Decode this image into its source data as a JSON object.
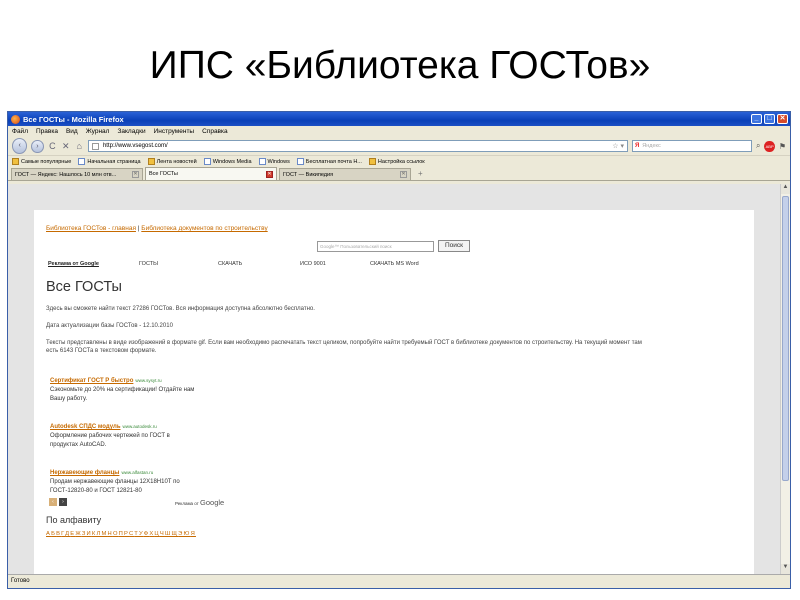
{
  "slide": {
    "title": "ИПС «Библиотека ГОСТов»"
  },
  "window": {
    "title": "Все ГОСТы - Mozilla Firefox",
    "min": "_",
    "max": "□",
    "close": "✕"
  },
  "menu": [
    "Файл",
    "Правка",
    "Вид",
    "Журнал",
    "Закладки",
    "Инструменты",
    "Справка"
  ],
  "nav": {
    "back": "‹",
    "forward": "›",
    "reload": "C",
    "stop": "✕",
    "home": "⌂",
    "url": "http://www.vsegost.com/",
    "star": "☆ ▾",
    "search_engine": "Я",
    "search_placeholder": "Яндекс"
  },
  "bookmarks": [
    "Самые популярные",
    "Начальная страница",
    "Лента новостей",
    "Windows Media",
    "Windows",
    "Бесплатная почта H...",
    "Настройка ссылок"
  ],
  "tabs": [
    {
      "label": "ГОСТ — Яндекс: Нашлось 10 млн отв...",
      "close": "✕"
    },
    {
      "label": "Все ГОСТы",
      "close": "✕"
    },
    {
      "label": "ГОСТ — Википедия",
      "close": "✕"
    }
  ],
  "tab_new": "+",
  "status": "Готово",
  "page": {
    "top_link_1": "Библиотека ГОСТов - главная",
    "top_sep": "|",
    "top_link_2": "Библиотека документов по строительству",
    "search_placeholder": "Google™ Пользовательский поиск",
    "search_button": "Поиск",
    "ads_nav": [
      "Реклама от Google",
      "ГОСТЫ",
      "СКАЧАТЬ",
      "ИСО 9001",
      "СКАЧАТЬ MS Word"
    ],
    "heading": "Все ГОСТы",
    "p1": "Здесь вы сможете найти текст 27286 ГОСТов. Вся информация доступна абсолютно бесплатно.",
    "p2": "Дата актуализации базы ГОСТов - 12.10.2010",
    "p3a": "Тексты представлены в виде изображений в формате gif. Если вам необходимо распечатать текст целиком, попробуйте найти требуемый ГОСТ в библиотеке документов по строительству. На текущий момент там",
    "p3b": "есть 6143 ГОСТа в текстовом формате.",
    "ads": [
      {
        "title": "Сертификат ГОСТ Р быстро",
        "url": "www.sysyt.ru",
        "line1": "Сэкономьте до 20% на сертификации! Отдайте нам",
        "line2": "Вашу работу."
      },
      {
        "title": "Autodesk СПДС модуль",
        "url": "www.autodesk.ru",
        "line1": "Оформление рабочих чертежей по ГОСТ в",
        "line2": "продуктах AutoCAD."
      },
      {
        "title": "Нержавеющие фланцы",
        "url": "www.alfastan.ru",
        "line1": "Продам нержавеющие фланцы 12Х18Н10Т по",
        "line2": "ГОСТ-12820-80 и ГОСТ 12821-80"
      }
    ],
    "pager_prev": "‹",
    "pager_next": "›",
    "ads_by": "Реклама от",
    "ads_by_brand": "Google",
    "alpha_title": "По алфавиту",
    "alphabet": [
      "А",
      "Б",
      "В",
      "Г",
      "Д",
      "Е",
      "Ж",
      "З",
      "И",
      "К",
      "Л",
      "М",
      "Н",
      "О",
      "П",
      "Р",
      "С",
      "Т",
      "У",
      "Ф",
      "Х",
      "Ц",
      "Ч",
      "Ш",
      "Щ",
      "Э",
      "Ю",
      "Я"
    ]
  }
}
